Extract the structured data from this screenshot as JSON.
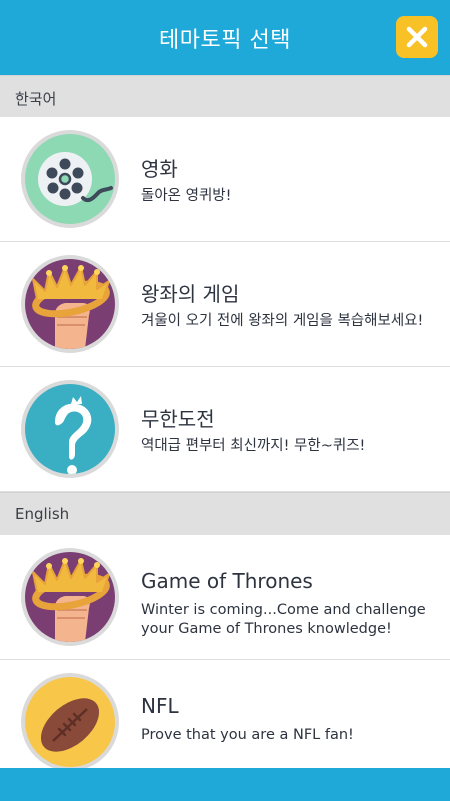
{
  "header": {
    "title": "테마토픽 선택",
    "close_icon": "close-icon",
    "accent_color": "#1fa9d9",
    "close_color": "#f8c126"
  },
  "sections": [
    {
      "label": "한국어",
      "items": [
        {
          "title": "영화",
          "desc": "돌아온 영퀴방!",
          "icon": "film-reel-icon"
        },
        {
          "title": "왕좌의 게임",
          "desc": "겨울이 오기 전에 왕좌의 게임을 복습해보세요!",
          "icon": "crown-fist-icon"
        },
        {
          "title": "무한도전",
          "desc": "역대급 편부터 최신까지! 무한~퀴즈!",
          "icon": "question-mark-icon"
        }
      ]
    },
    {
      "label": "English",
      "items": [
        {
          "title": "Game of Thrones",
          "desc": "Winter is coming...Come and challenge your Game of Thrones knowledge!",
          "icon": "crown-fist-icon"
        },
        {
          "title": "NFL",
          "desc": "Prove that you are a NFL fan!",
          "icon": "football-icon"
        }
      ]
    }
  ]
}
